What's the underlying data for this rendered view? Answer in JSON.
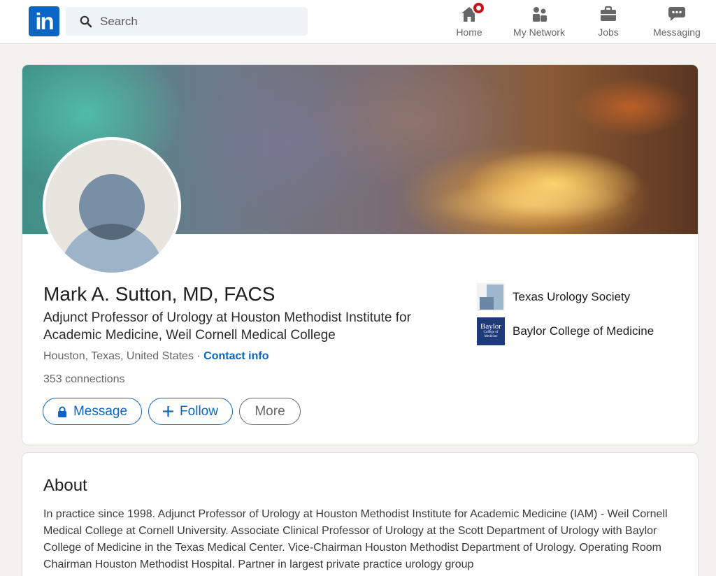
{
  "nav": {
    "logo_text": "in",
    "search_placeholder": "Search",
    "items": [
      {
        "label": "Home",
        "icon": "home-icon",
        "has_notification": true
      },
      {
        "label": "My Network",
        "icon": "network-icon"
      },
      {
        "label": "Jobs",
        "icon": "briefcase-icon"
      },
      {
        "label": "Messaging",
        "icon": "message-icon"
      }
    ]
  },
  "profile": {
    "name": "Mark A. Sutton, MD, FACS",
    "headline": "Adjunct Professor of Urology at Houston Methodist Institute for Academic Medicine, Weil Cornell Medical College",
    "location": "Houston, Texas, United States",
    "separator": " · ",
    "contact_label": "Contact info",
    "connections": "353 connections",
    "buttons": {
      "message": "Message",
      "follow": "Follow",
      "more": "More"
    },
    "organizations": [
      {
        "name": "Texas Urology Society"
      },
      {
        "name": "Baylor College of Medicine",
        "logo_text_main": "Baylor",
        "logo_text_sub": "College of Medicine"
      }
    ]
  },
  "about": {
    "title": "About",
    "text": "In practice since 1998. Adjunct Professor of Urology at Houston Methodist Institute for Academic Medicine (IAM) - Weil Cornell Medical College at Cornell University. Associate Clinical Professor of Urology at the Scott Department of Urology with Baylor College of Medicine in the Texas Medical Center. Vice-Chairman Houston Methodist Department of Urology. Operating Room Chairman Houston Methodist Hospital. Partner in largest private practice urology group"
  },
  "colors": {
    "brand_blue": "#0a66c2",
    "background": "#f3f2ef",
    "notification_red": "#cc1016"
  }
}
